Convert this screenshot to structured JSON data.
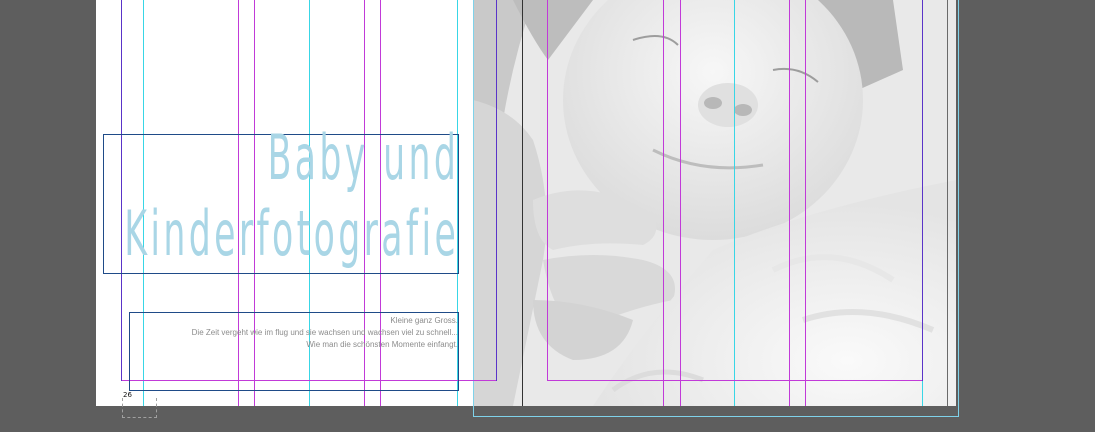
{
  "document": {
    "page_number": "26",
    "title_line_1": "Baby und",
    "title_line_2": "Kinderfotografie",
    "body_lines": [
      "Kleine ganz Gross.",
      "Die Zeit vergeht wie im flug und sie wachsen und wachsen viel zu schnell...",
      "Wie man die schönsten Momente einfangt."
    ],
    "image": "newborn-baby-photo"
  },
  "colors": {
    "pasteboard": "#5e5e5e",
    "page": "#ffffff",
    "title_text": "#a9d6e6",
    "body_text": "#8c8c8c",
    "column_guide": "#38d6e6",
    "margin_guide": "#c13ad8",
    "bleed_guide": "#5a34c8",
    "text_frame": "#1f4b88"
  }
}
